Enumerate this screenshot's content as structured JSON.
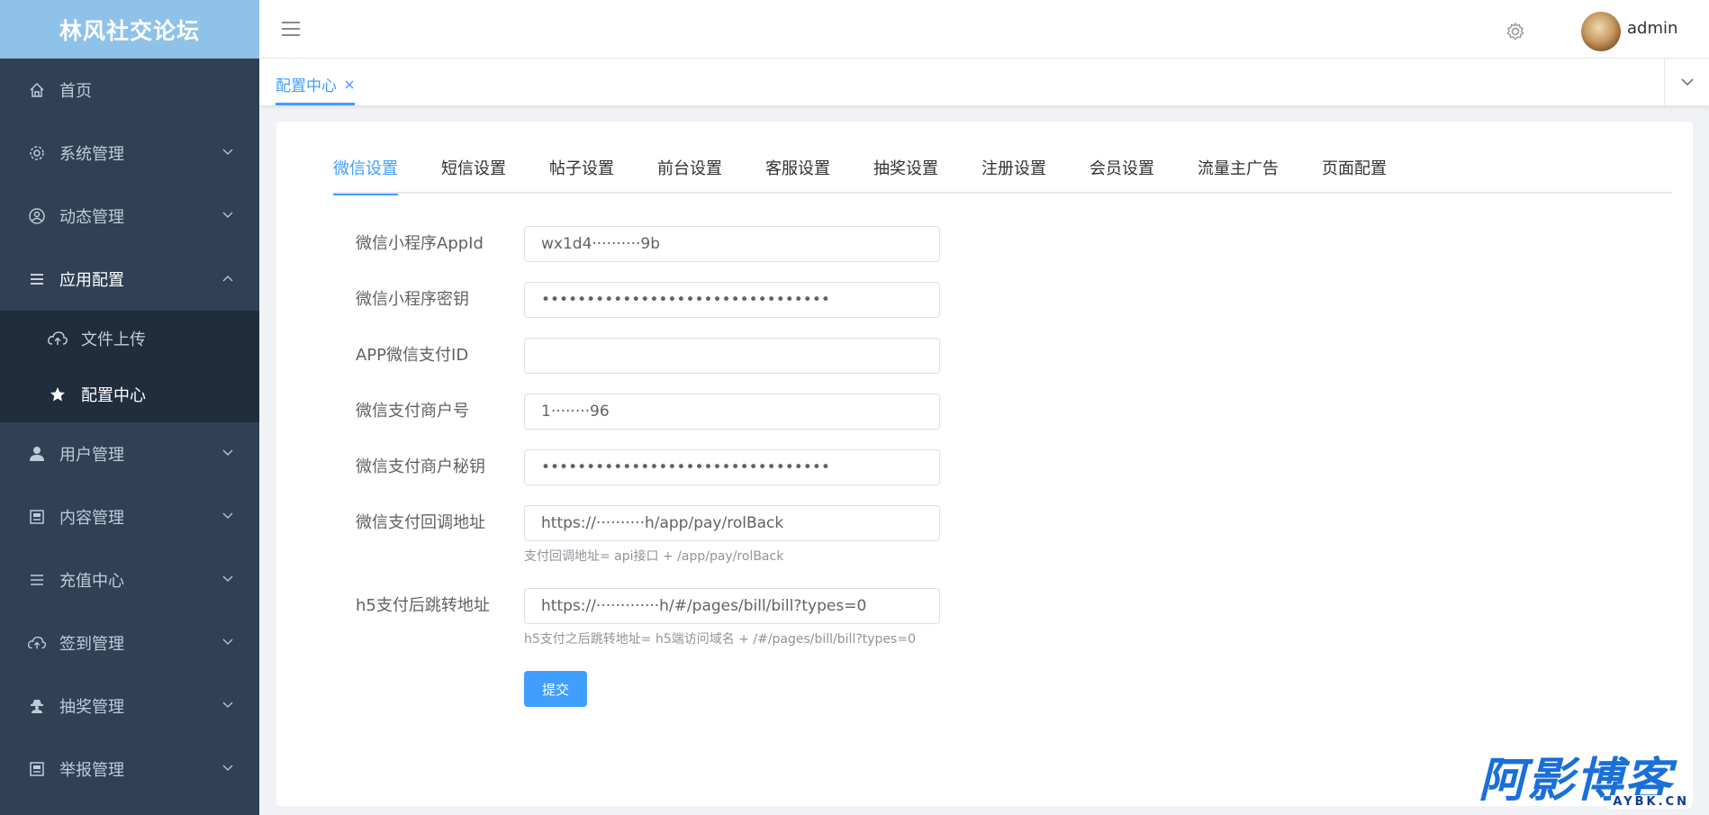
{
  "app": {
    "logo": "林风社交论坛"
  },
  "sidebar": {
    "items": [
      {
        "label": "首页"
      },
      {
        "label": "系统管理"
      },
      {
        "label": "动态管理"
      },
      {
        "label": "应用配置"
      },
      {
        "label": "用户管理"
      },
      {
        "label": "内容管理"
      },
      {
        "label": "充值中心"
      },
      {
        "label": "签到管理"
      },
      {
        "label": "抽奖管理"
      },
      {
        "label": "举报管理"
      }
    ],
    "submenu": [
      {
        "label": "文件上传"
      },
      {
        "label": "配置中心"
      }
    ]
  },
  "header": {
    "username": "admin"
  },
  "tags": [
    {
      "label": "配置中心"
    }
  ],
  "tabs": [
    {
      "label": "微信设置"
    },
    {
      "label": "短信设置"
    },
    {
      "label": "帖子设置"
    },
    {
      "label": "前台设置"
    },
    {
      "label": "客服设置"
    },
    {
      "label": "抽奖设置"
    },
    {
      "label": "注册设置"
    },
    {
      "label": "会员设置"
    },
    {
      "label": "流量主广告"
    },
    {
      "label": "页面配置"
    }
  ],
  "form": {
    "fields": [
      {
        "label": "微信小程序AppId",
        "value": "wx1d4··········9b"
      },
      {
        "label": "微信小程序密钥",
        "value": "••••••••••••••••••••••••••••••••"
      },
      {
        "label": "APP微信支付ID",
        "value": ""
      },
      {
        "label": "微信支付商户号",
        "value": "1········96"
      },
      {
        "label": "微信支付商户秘钥",
        "value": "••••••••••••••••••••••••••••••••"
      },
      {
        "label": "微信支付回调地址",
        "value": "https://··········h/app/pay/rolBack",
        "help": "支付回调地址= api接口 + /app/pay/rolBack"
      },
      {
        "label": "h5支付后跳转地址",
        "value": "https://·············h/#/pages/bill/bill?types=0",
        "help": "h5支付之后跳转地址= h5端访问域名 + /#/pages/bill/bill?types=0"
      }
    ],
    "submit_label": "提交"
  },
  "watermark": {
    "main": "阿影博客",
    "sub": "AYBK.CN"
  },
  "colors": {
    "accent": "#409eff",
    "sidebar_bg": "#304156",
    "logo_bg": "#8ec2e8"
  }
}
